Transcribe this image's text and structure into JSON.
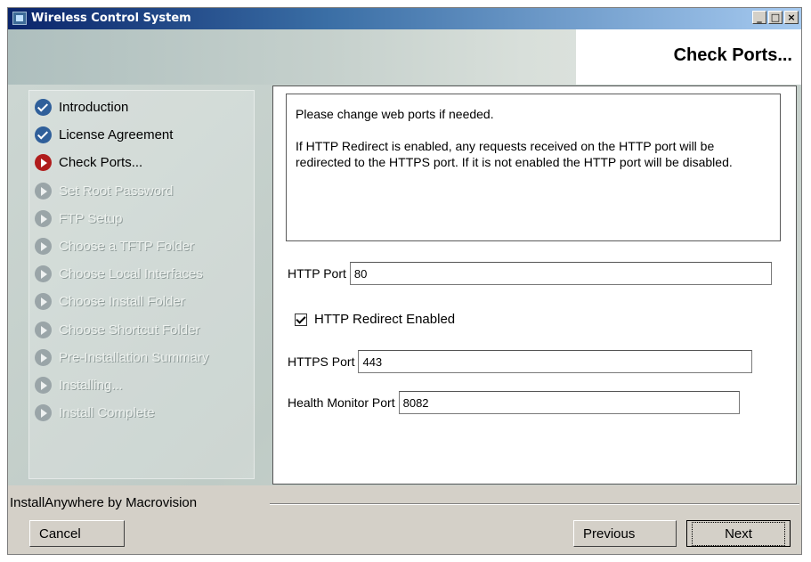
{
  "window": {
    "title": "Wireless Control System",
    "controls": [
      "minimize",
      "maximize",
      "close"
    ]
  },
  "header": {
    "page_title": "Check Ports..."
  },
  "steps": [
    {
      "label": "Introduction",
      "state": "done"
    },
    {
      "label": "License Agreement",
      "state": "done"
    },
    {
      "label": "Check Ports...",
      "state": "current"
    },
    {
      "label": "Set Root Password",
      "state": "pending"
    },
    {
      "label": "FTP Setup",
      "state": "pending"
    },
    {
      "label": "Choose a TFTP Folder",
      "state": "pending"
    },
    {
      "label": "Choose Local Interfaces",
      "state": "pending"
    },
    {
      "label": "Choose Install Folder",
      "state": "pending"
    },
    {
      "label": "Choose Shortcut Folder",
      "state": "pending"
    },
    {
      "label": "Pre-Installation Summary",
      "state": "pending"
    },
    {
      "label": "Installing...",
      "state": "pending"
    },
    {
      "label": "Install Complete",
      "state": "pending"
    }
  ],
  "info": {
    "line1": "Please change web ports if needed.",
    "line2": "If HTTP Redirect is enabled, any requests received on the HTTP port will be redirected to the HTTPS port.  If it is not enabled the HTTP port will be disabled."
  },
  "form": {
    "http_port_label": "HTTP Port",
    "http_port_value": "80",
    "redirect_label": "HTTP Redirect Enabled",
    "redirect_checked": true,
    "https_port_label": "HTTPS Port",
    "https_port_value": "443",
    "health_port_label": "Health Monitor Port",
    "health_port_value": "8082"
  },
  "footer": {
    "brand": "InstallAnywhere by Macrovision",
    "cancel_label": "Cancel",
    "previous_label": "Previous",
    "next_label": "Next"
  }
}
